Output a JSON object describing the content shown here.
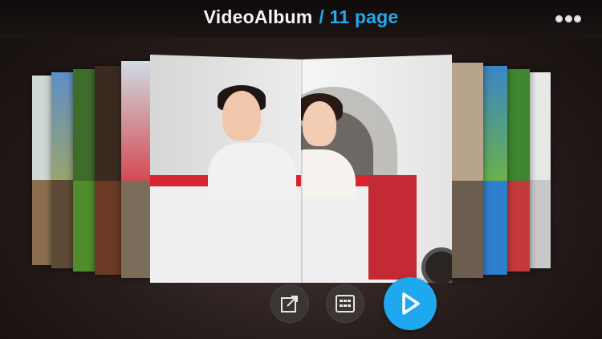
{
  "header": {
    "app_title": "VideoAlbum",
    "separator": "/",
    "page_count_label": "11 page",
    "more_icon": "more-dots-icon"
  },
  "album": {
    "open_book_photo": "couple-in-car-photo",
    "left_stack_count": 5,
    "right_stack_count": 4
  },
  "controls": {
    "share_icon": "share-icon",
    "grid_icon": "grid-icon",
    "play_icon": "play-icon"
  },
  "colors": {
    "accent": "#1fa8ee",
    "title_text": "#f4f4f4",
    "button_bg": "#3b3634"
  }
}
